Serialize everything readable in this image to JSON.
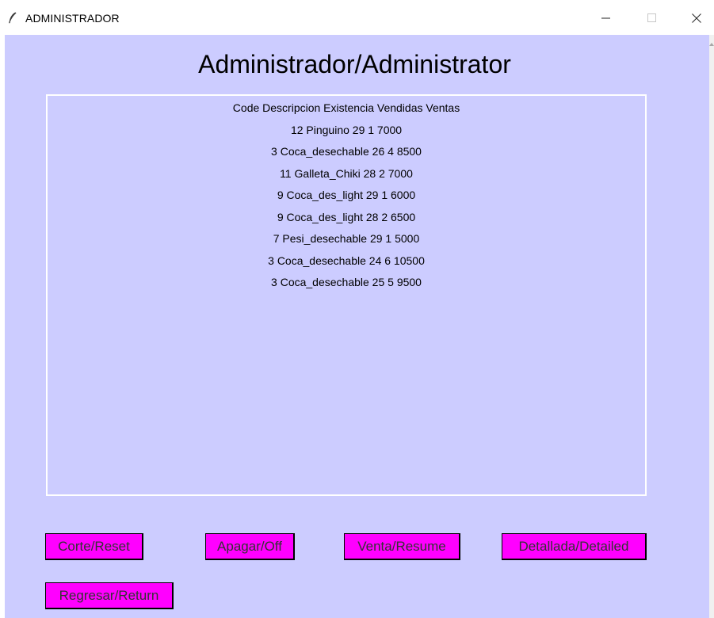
{
  "window": {
    "title": "ADMINISTRADOR",
    "minimize_glyph": "—",
    "maximize_glyph": "☐",
    "close_glyph": "✕"
  },
  "main": {
    "heading": "Administrador/Administrator",
    "list": {
      "header": "Code Descripcion Existencia Vendidas Ventas",
      "rows": [
        "12 Pinguino 29 1 7000",
        "3 Coca_desechable 26 4 8500",
        "11 Galleta_Chiki 28 2 7000",
        "9 Coca_des_light 29 1 6000",
        "9 Coca_des_light 28 2 6500",
        "7 Pesi_desechable 29 1 5000",
        "3 Coca_desechable 24 6 10500",
        "3 Coca_desechable 25 5 9500"
      ]
    }
  },
  "buttons": {
    "reset": "Corte/Reset",
    "off": "Apagar/Off",
    "resume": "Venta/Resume",
    "detailed": "Detallada/Detailed",
    "return": "Regresar/Return"
  },
  "colors": {
    "client_bg": "#ccccff",
    "button_bg": "#ff00ff",
    "list_border": "#ffffff"
  },
  "icons": {
    "app": "feather-icon",
    "minimize": "minimize-icon",
    "maximize": "maximize-icon",
    "close": "close-icon"
  }
}
